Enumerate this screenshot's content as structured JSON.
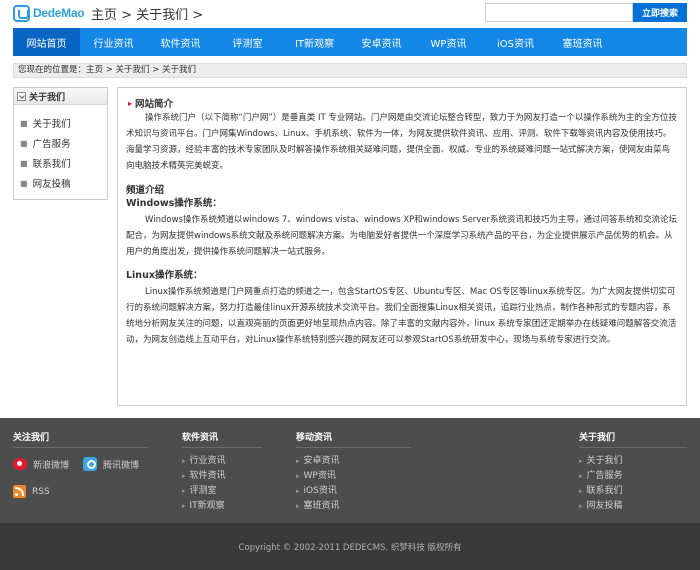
{
  "header": {
    "logo_text": "DedeMao",
    "title": "主页 > 关于我们 >",
    "search_placeholder": "",
    "search_button": "立即搜索"
  },
  "nav": {
    "items": [
      {
        "label": "网站首页"
      },
      {
        "label": "行业资讯"
      },
      {
        "label": "软件资讯"
      },
      {
        "label": "评测室"
      },
      {
        "label": "IT新观察"
      },
      {
        "label": "安卓资讯"
      },
      {
        "label": "WP资讯"
      },
      {
        "label": "iOS资讯"
      },
      {
        "label": "塞班资讯"
      }
    ]
  },
  "location": "您现在的位置是：主页 > 关于我们 > 关于我们",
  "sidebar": {
    "title": "关于我们",
    "items": [
      {
        "label": "关于我们"
      },
      {
        "label": "广告服务"
      },
      {
        "label": "联系我们"
      },
      {
        "label": "网友投稿"
      }
    ]
  },
  "main": {
    "intro_title": "网站简介",
    "intro_text": "操作系统门户（以下简称“门户网”）是垂直类 IT 专业网站。门户网是由交流论坛整合转型，致力于为网友打造一个以操作系统为主的全方位技术知识与资讯平台。门户网集Windows、Linux、手机系统、软件为一体，为网友提供软件资讯、应用、评测、软件下载等资讯内容及使用技巧。海量学习资源，经验丰富的技术专家团队及时解答操作系统相关疑难问题，提供全面、权威、专业的系统疑难问题一站式解决方案，使网友由菜鸟向电脑技术精英完美蜕变。",
    "channel_title": "频道介绍",
    "windows_title": "Windows操作系统：",
    "windows_text": "Windows操作系统频道以windows 7、windows vista、windows XP和windows Server系统资讯和技巧为主导，通过问答系统和交流论坛配合，为网友提供windows系统文献及系统问题解决方案。为电脑爱好者提供一个深度学习系统产品的平台，为企业提供展示产品优势的机会。从用户的角度出发，提供操作系统问题解决一站式服务。",
    "linux_title": "Linux操作系统：",
    "linux_text": "Linux操作系统频道是门户网重点打造的频道之一，包含StartOS专区、Ubuntu专区、Mac OS专区等linux系统专区。为广大网友提供切实可行的系统问题解决方案，努力打造最佳linux开源系统技术交流平台。我们全面搜集Linux相关资讯，追踪行业热点，制作各种形式的专题内容，系统地分析网友关注的问题，以直观亮丽的页面更好地呈现热点内容。除了丰富的文献内容外，linux 系统专家团还定期举办在线疑难问题解答交流活动，为网友创造线上互动平台，对Linux操作系统特别感兴趣的网友还可以参观StartOS系统研发中心，现场与系统专家进行交流。"
  },
  "footer": {
    "follow_title": "关注我们",
    "weibo_sina": "新浪微博",
    "weibo_tencent": "腾讯微博",
    "rss": "RSS",
    "software_title": "软件资讯",
    "software_links": [
      {
        "label": "行业资讯"
      },
      {
        "label": "软件资讯"
      },
      {
        "label": "评测室"
      },
      {
        "label": "IT新观察"
      }
    ],
    "mobile_title": "移动资讯",
    "mobile_links": [
      {
        "label": "安卓资讯"
      },
      {
        "label": "WP资讯"
      },
      {
        "label": "iOS资讯"
      },
      {
        "label": "塞班资讯"
      }
    ],
    "about_title": "关于我们",
    "about_links": [
      {
        "label": "关于我们"
      },
      {
        "label": "广告服务"
      },
      {
        "label": "联系我们"
      },
      {
        "label": "网友投稿"
      }
    ],
    "copyright": "Copyright © 2002-2011 DEDECMS. 织梦科技 版权所有"
  },
  "colors": {
    "nav_bg": "#1587e6",
    "nav_active": "#0a66c4",
    "search_button": "#0070d8",
    "footer_bg": "#4d4d4d",
    "copyright_bg": "#3a3a3a"
  }
}
